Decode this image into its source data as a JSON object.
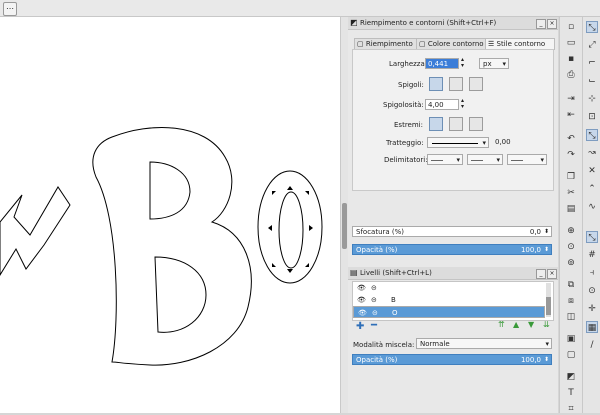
{
  "fill_stroke": {
    "title": "Riempimento e contorni (Shift+Ctrl+F)",
    "tabs": [
      "Riempimento",
      "Colore contorno",
      "Stile contorno"
    ],
    "width_label": "Larghezza:",
    "width_value": "0,441",
    "unit": "px",
    "join_label": "Spigoli:",
    "miter_label": "Spigolosità:",
    "miter_value": "4,00",
    "caps_label": "Estremi:",
    "dashes_label": "Tratteggio:",
    "dash_offset": "0,00",
    "markers_label": "Delimitatori:",
    "blur_label": "Sfocatura (%)",
    "blur_value": "0,0",
    "opacity_label": "Opacità (%)",
    "opacity_value": "100,0",
    "opacity_fraction": 1.0
  },
  "layers": {
    "title": "Livelli (Shift+Ctrl+L)",
    "rows": [
      {
        "name": ""
      },
      {
        "name": "B"
      },
      {
        "name": "O"
      }
    ],
    "selected_index": 2,
    "blend_label": "Modalità miscela:",
    "blend_value": "Normale",
    "opacity_label": "Opacità (%)",
    "opacity_value": "100,0",
    "opacity_fraction": 1.0
  },
  "icons": {
    "top": "command-bar-icon",
    "panel": "fill-stroke-icon",
    "layers": "layers-icon"
  }
}
